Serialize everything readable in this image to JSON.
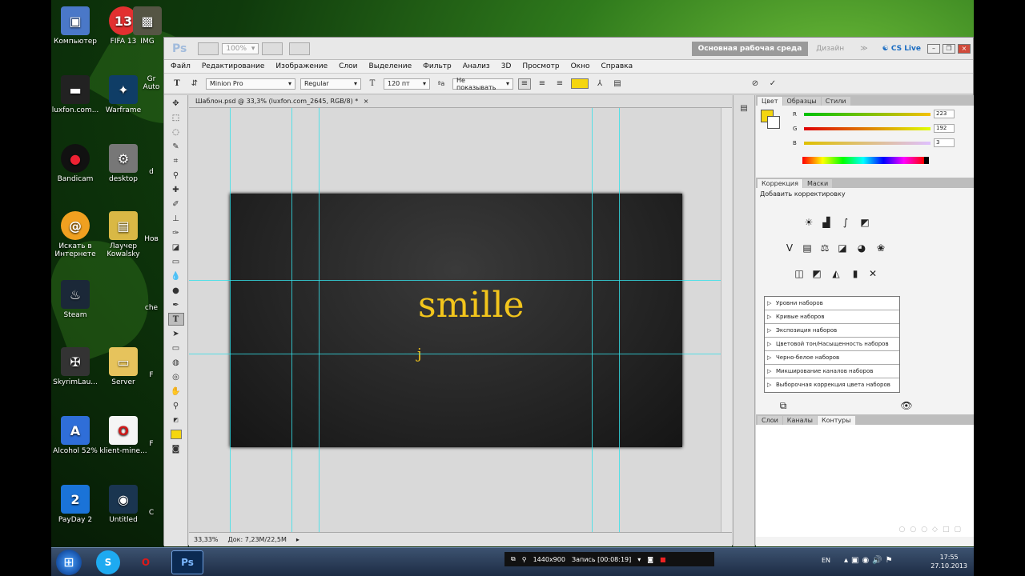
{
  "desktop": {
    "icons": [
      {
        "label": "Компьютер",
        "icon": "computer-icon"
      },
      {
        "label": "FIFA 13",
        "icon": "fifa-icon"
      },
      {
        "label": "IMG",
        "icon": "image-icon"
      },
      {
        "label": "luxfon.com...",
        "icon": "luxfon-icon"
      },
      {
        "label": "Warframe",
        "icon": "warframe-icon"
      },
      {
        "label": "Gr Auto",
        "icon": "gta-icon"
      },
      {
        "label": "Bandicam",
        "icon": "bandicam-icon"
      },
      {
        "label": "desktop",
        "icon": "desktop-icon"
      },
      {
        "label": "d",
        "icon": "file-icon"
      },
      {
        "label": "Искать в Интернете",
        "icon": "search-internet-icon"
      },
      {
        "label": "Лаучер Kowalsky",
        "icon": "launcher-icon"
      },
      {
        "label": "Нов",
        "icon": "file-icon"
      },
      {
        "label": "Steam",
        "icon": "steam-icon"
      },
      {
        "label": "che",
        "icon": "file-icon"
      },
      {
        "label": "SkyrimLau...",
        "icon": "skyrim-icon"
      },
      {
        "label": "Server",
        "icon": "folder-icon"
      },
      {
        "label": "F",
        "icon": "file-icon"
      },
      {
        "label": "Alcohol 52%",
        "icon": "alcohol-icon"
      },
      {
        "label": "klient-mine...",
        "icon": "opera-file-icon"
      },
      {
        "label": "F",
        "icon": "file-icon"
      },
      {
        "label": "PayDay 2",
        "icon": "payday-icon"
      },
      {
        "label": "Untitled",
        "icon": "untitled-icon"
      },
      {
        "label": "C",
        "icon": "file-icon"
      }
    ]
  },
  "ps": {
    "logo": "Ps",
    "zoom_select": "100%",
    "workspace_active": "Основная рабочая среда",
    "workspace_other": "Дизайн",
    "more": "≫",
    "cs_live": "CS Live",
    "menu": [
      "Файл",
      "Редактирование",
      "Изображение",
      "Слои",
      "Выделение",
      "Фильтр",
      "Анализ",
      "3D",
      "Просмотр",
      "Окно",
      "Справка"
    ],
    "options": {
      "font_family": "Minion Pro",
      "font_style": "Regular",
      "font_size": "120 пт",
      "aa_label": "ªa",
      "antialias": "Не показывать",
      "text_color": "#f5d60f"
    },
    "doc_tab": "Шаблон.psd @ 33,3% (luxfon.com_2645, RGB/8) *",
    "doc_close": "×",
    "canvas_text_main": "smille",
    "canvas_text_sub": "j",
    "status_zoom": "33,33%",
    "status_doc": "Док: 7,23M/22,5M",
    "color_panel": {
      "tabs": [
        "Цвет",
        "Образцы",
        "Стили"
      ],
      "r_label": "R",
      "r_value": "223",
      "g_label": "G",
      "g_value": "192",
      "b_label": "B",
      "b_value": "3",
      "fg_color": "#dfc003"
    },
    "adjust_panel": {
      "tabs": [
        "Коррекция",
        "Маски"
      ],
      "heading": "Добавить корректировку",
      "presets": [
        "Уровни наборов",
        "Кривые наборов",
        "Экспозиция наборов",
        "Цветовой тон/Насыщенность наборов",
        "Черно-белое наборов",
        "Микширование каналов наборов",
        "Выборочная коррекция цвета наборов"
      ]
    },
    "layers_panel": {
      "tabs": [
        "Слои",
        "Каналы",
        "Контуры"
      ]
    }
  },
  "taskbar": {
    "record_res": "1440x900",
    "record_time": "Запись [00:08:19]",
    "lang": "EN",
    "time": "17:55",
    "date": "27.10.2013"
  }
}
